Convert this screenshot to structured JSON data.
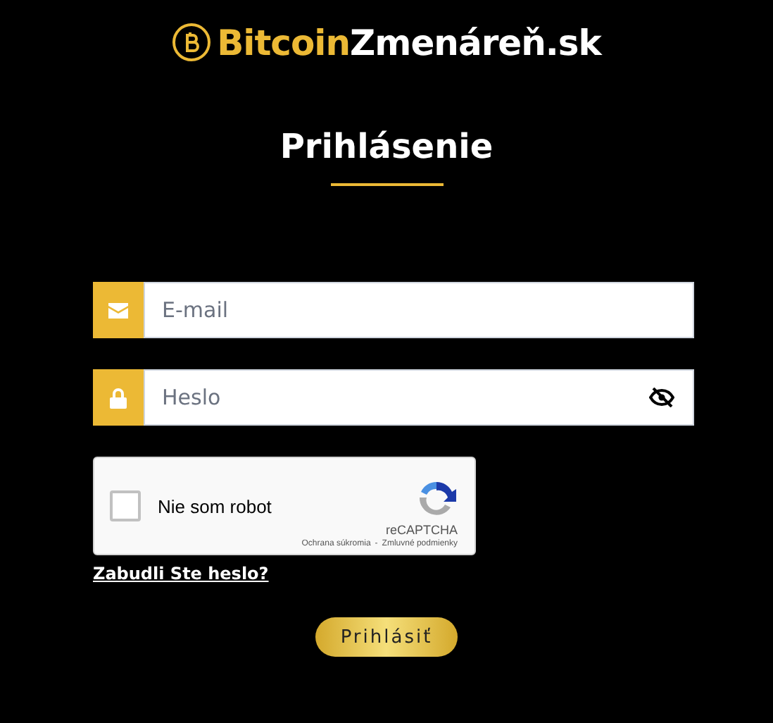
{
  "logo": {
    "part_1": "Bitcoin",
    "part_2": "Zmenáreň.sk"
  },
  "title": "Prihlásenie",
  "fields": [
    {
      "kind": "email",
      "placeholder": "E-mail"
    },
    {
      "kind": "password",
      "placeholder": "Heslo"
    }
  ],
  "captcha": {
    "label": "Nie som robot",
    "checked": false,
    "brand": "reCAPTCHA",
    "privacy": "Ochrana súkromia",
    "separator": "-",
    "terms": "Zmluvné podmienky"
  },
  "forgot_link": "Zabudli Ste heslo?",
  "submit": "Prihlásiť"
}
